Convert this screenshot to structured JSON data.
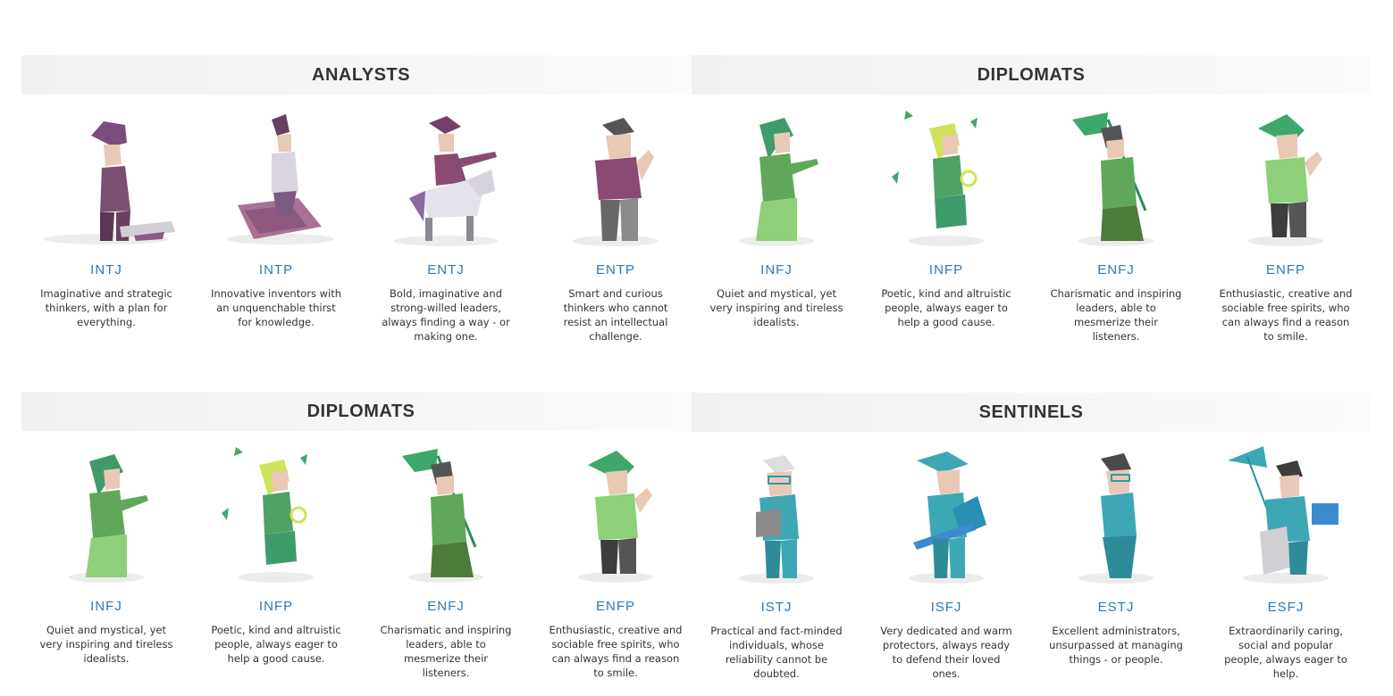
{
  "top_labels": [
    "",
    "",
    "",
    ""
  ],
  "colors": {
    "analysts": "#86577a",
    "diplomats": "#5fa85a",
    "sentinels": "#3ea7b6",
    "code_link": "#2a7ab8",
    "band": "#f3f3f3"
  },
  "groups": [
    {
      "title": "ANALYSTS",
      "cards": [
        {
          "code": "INTJ",
          "desc": "Imaginative and strategic thinkers, with a plan for everything.",
          "icon": "architect-figure-icon"
        },
        {
          "code": "INTP",
          "desc": "Innovative inventors with an unquenchable thirst for knowledge.",
          "icon": "logician-figure-icon"
        },
        {
          "code": "ENTJ",
          "desc": "Bold, imaginative and strong-willed leaders, always finding a way - or making one.",
          "icon": "commander-figure-icon"
        },
        {
          "code": "ENTP",
          "desc": "Smart and curious thinkers who cannot resist an intellectual challenge.",
          "icon": "debater-figure-icon"
        }
      ]
    },
    {
      "title": "DIPLOMATS",
      "cards": [
        {
          "code": "INFJ",
          "desc": "Quiet and mystical, yet very inspiring and tireless idealists.",
          "icon": "advocate-figure-icon"
        },
        {
          "code": "INFP",
          "desc": "Poetic, kind and altruistic people, always eager to help a good cause.",
          "icon": "mediator-figure-icon"
        },
        {
          "code": "ENFJ",
          "desc": "Charismatic and inspiring leaders, able to mesmerize their listeners.",
          "icon": "protagonist-figure-icon"
        },
        {
          "code": "ENFP",
          "desc": "Enthusiastic, creative and sociable free spirits, who can always find a reason to smile.",
          "icon": "campaigner-figure-icon"
        }
      ]
    },
    {
      "title": "DIPLOMATS",
      "cards": [
        {
          "code": "INFJ",
          "desc": "Quiet and mystical, yet very inspiring and tireless idealists.",
          "icon": "advocate-figure-icon"
        },
        {
          "code": "INFP",
          "desc": "Poetic, kind and altruistic people, always eager to help a good cause.",
          "icon": "mediator-figure-icon"
        },
        {
          "code": "ENFJ",
          "desc": "Charismatic and inspiring leaders, able to mesmerize their listeners.",
          "icon": "protagonist-figure-icon"
        },
        {
          "code": "ENFP",
          "desc": "Enthusiastic, creative and sociable free spirits, who can always find a reason to smile.",
          "icon": "campaigner-figure-icon"
        }
      ]
    },
    {
      "title": "SENTINELS",
      "cards": [
        {
          "code": "ISTJ",
          "desc": "Practical and fact-minded individuals, whose reliability cannot be doubted.",
          "icon": "logistician-figure-icon"
        },
        {
          "code": "ISFJ",
          "desc": "Very dedicated and warm protectors, always ready to defend their loved ones.",
          "icon": "defender-figure-icon"
        },
        {
          "code": "ESTJ",
          "desc": "Excellent administrators, unsurpassed at managing things - or people.",
          "icon": "executive-figure-icon"
        },
        {
          "code": "ESFJ",
          "desc": "Extraordinarily caring, social and popular people, always eager to help.",
          "icon": "consul-figure-icon"
        }
      ]
    }
  ]
}
